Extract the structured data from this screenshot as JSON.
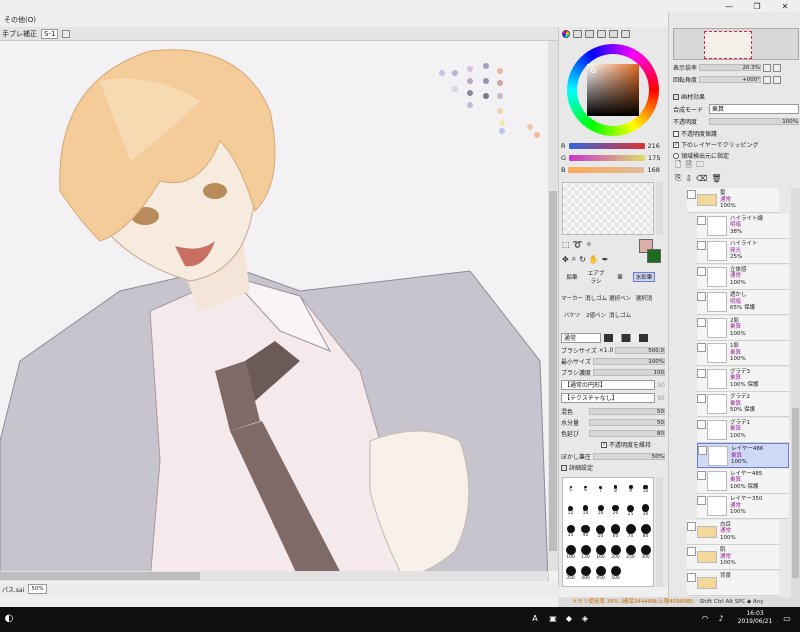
{
  "menu": {
    "other": "その他(O)"
  },
  "toolopts": {
    "label": "手ブレ補正",
    "value": "S-1"
  },
  "canvas_status": {
    "filename": "パス.sai",
    "zoom": "50%"
  },
  "color": {
    "r_label": "R",
    "r_value": "216",
    "g_label": "G",
    "g_value": "175",
    "b_label": "B",
    "b_value": "168",
    "fg_color": "#dcb0a8",
    "bg_color": "#1f6b1f"
  },
  "tools": {
    "row1": [
      "鉛筆",
      "エアブラシ",
      "筆",
      "水彩筆"
    ],
    "row2": [
      "マーカー",
      "消しゴム",
      "選択ペン",
      "選択消"
    ],
    "row3": [
      "バケツ",
      "2値ペン",
      "消しゴム",
      ""
    ]
  },
  "brush": {
    "mode": "通常",
    "size_label": "ブラシサイズ",
    "size_mult": "×1.0",
    "size_value": "500.0",
    "min_label": "最小サイズ",
    "min_value": "100%",
    "density_label": "ブラシ濃度",
    "density_value": "100",
    "shape": "【通常の円形】",
    "shape_val": "50",
    "texture": "【テクスチャなし】",
    "texture_val": "95",
    "blend_label": "混色",
    "blend_value": "50",
    "water_label": "水分量",
    "water_value": "50",
    "stretch_label": "色延び",
    "stretch_value": "80",
    "keep_opacity": "不透明度を維持",
    "blur_label": "ぼかし筆圧",
    "blur_value": "50%",
    "detail": "詳細設定",
    "sizes": [
      "5",
      "6",
      "7",
      "8",
      "9",
      "10",
      "12",
      "14",
      "16",
      "20",
      "25",
      "30",
      "35",
      "40",
      "50",
      "60",
      "70",
      "80",
      "100",
      "120",
      "160",
      "200",
      "250",
      "300",
      "350",
      "400",
      "450",
      "500"
    ]
  },
  "nav": {
    "zoom_label": "表示倍率",
    "zoom_value": "20.3%",
    "rotate_label": "回転角度",
    "rotate_value": "+000°"
  },
  "layerprops": {
    "effect": "画材効果",
    "mode_label": "合成モード",
    "mode_value": "乗算",
    "opacity_label": "不透明度",
    "opacity_value": "100%",
    "opt1": "不透明度保護",
    "opt2": "下のレイヤーでクリッピング",
    "opt3": "領域検出元に指定"
  },
  "layers": [
    {
      "name": "髪",
      "blend": "通常",
      "opacity": "100%",
      "folder": true
    },
    {
      "name": "ハイライト線",
      "blend": "明暗",
      "opacity": "38%"
    },
    {
      "name": "ハイライト",
      "blend": "発光",
      "opacity": "25%"
    },
    {
      "name": "立体感",
      "blend": "通常",
      "opacity": "100%"
    },
    {
      "name": "透かし",
      "blend": "明暗",
      "opacity": "65%",
      "note": "保護"
    },
    {
      "name": "2影",
      "blend": "乗算",
      "opacity": "100%"
    },
    {
      "name": "1影",
      "blend": "乗算",
      "opacity": "100%"
    },
    {
      "name": "グラデ3",
      "blend": "乗算",
      "opacity": "100%",
      "note": "保護"
    },
    {
      "name": "グラデ2",
      "blend": "乗算",
      "opacity": "50%",
      "note": "保護"
    },
    {
      "name": "グラデ1",
      "blend": "乗算",
      "opacity": "100%"
    },
    {
      "name": "レイヤー486",
      "blend": "乗算",
      "opacity": "100%",
      "selected": true
    },
    {
      "name": "レイヤー485",
      "blend": "乗算",
      "opacity": "100%",
      "note": "保護"
    },
    {
      "name": "レイヤー350",
      "blend": "通常",
      "opacity": "100%"
    },
    {
      "name": "白目",
      "blend": "通常",
      "opacity": "100%",
      "folder": true
    },
    {
      "name": "肌",
      "blend": "通常",
      "opacity": "100%",
      "folder": true
    },
    {
      "name": "背景",
      "blend": "",
      "opacity": "",
      "folder": true
    }
  ],
  "status": {
    "memory": "メモリ使用率 34% (確保3444MB/上限4096MB)",
    "keys": "Shift Ctrl Alt SPC ◆ Any"
  },
  "taskbar": {
    "time": "16:03",
    "date": "2019/06/21",
    "ime": "A"
  }
}
